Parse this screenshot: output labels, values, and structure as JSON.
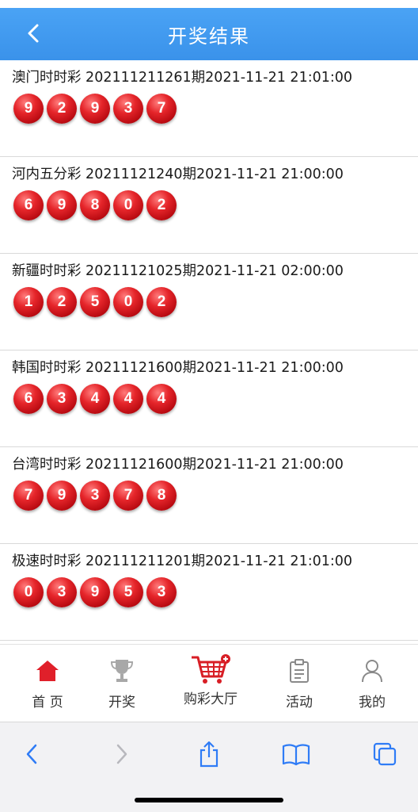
{
  "header": {
    "title": "开奖结果"
  },
  "results": [
    {
      "label": "澳门时时彩 202111211261期2021-11-21 21:01:00",
      "numbers": [
        "9",
        "2",
        "9",
        "3",
        "7"
      ]
    },
    {
      "label": "河内五分彩 20211121240期2021-11-21 21:00:00",
      "numbers": [
        "6",
        "9",
        "8",
        "0",
        "2"
      ]
    },
    {
      "label": "新疆时时彩 20211121025期2021-11-21 02:00:00",
      "numbers": [
        "1",
        "2",
        "5",
        "0",
        "2"
      ]
    },
    {
      "label": "韩国时时彩 20211121600期2021-11-21 21:00:00",
      "numbers": [
        "6",
        "3",
        "4",
        "4",
        "4"
      ]
    },
    {
      "label": "台湾时时彩 20211121600期2021-11-21 21:00:00",
      "numbers": [
        "7",
        "9",
        "3",
        "7",
        "8"
      ]
    },
    {
      "label": "极速时时彩 202111211201期2021-11-21 21:01:00",
      "numbers": [
        "0",
        "3",
        "9",
        "5",
        "3"
      ]
    }
  ],
  "tabbar": {
    "items": [
      {
        "label": "首 页",
        "icon": "home-icon",
        "active": true
      },
      {
        "label": "开奖",
        "icon": "trophy-icon"
      },
      {
        "label": "购彩大厅",
        "icon": "shopping-cart-icon"
      },
      {
        "label": "活动",
        "icon": "clipboard-icon"
      },
      {
        "label": "我的",
        "icon": "user-icon"
      }
    ]
  },
  "browser_toolbar": {
    "icons": [
      "back-icon",
      "forward-icon",
      "share-icon",
      "bookmarks-icon",
      "tabs-icon"
    ]
  },
  "colors": {
    "header": "#3a92ea",
    "ball": "#d81e25",
    "accent": "#e0202a",
    "ios_blue": "#2f7cf6"
  }
}
